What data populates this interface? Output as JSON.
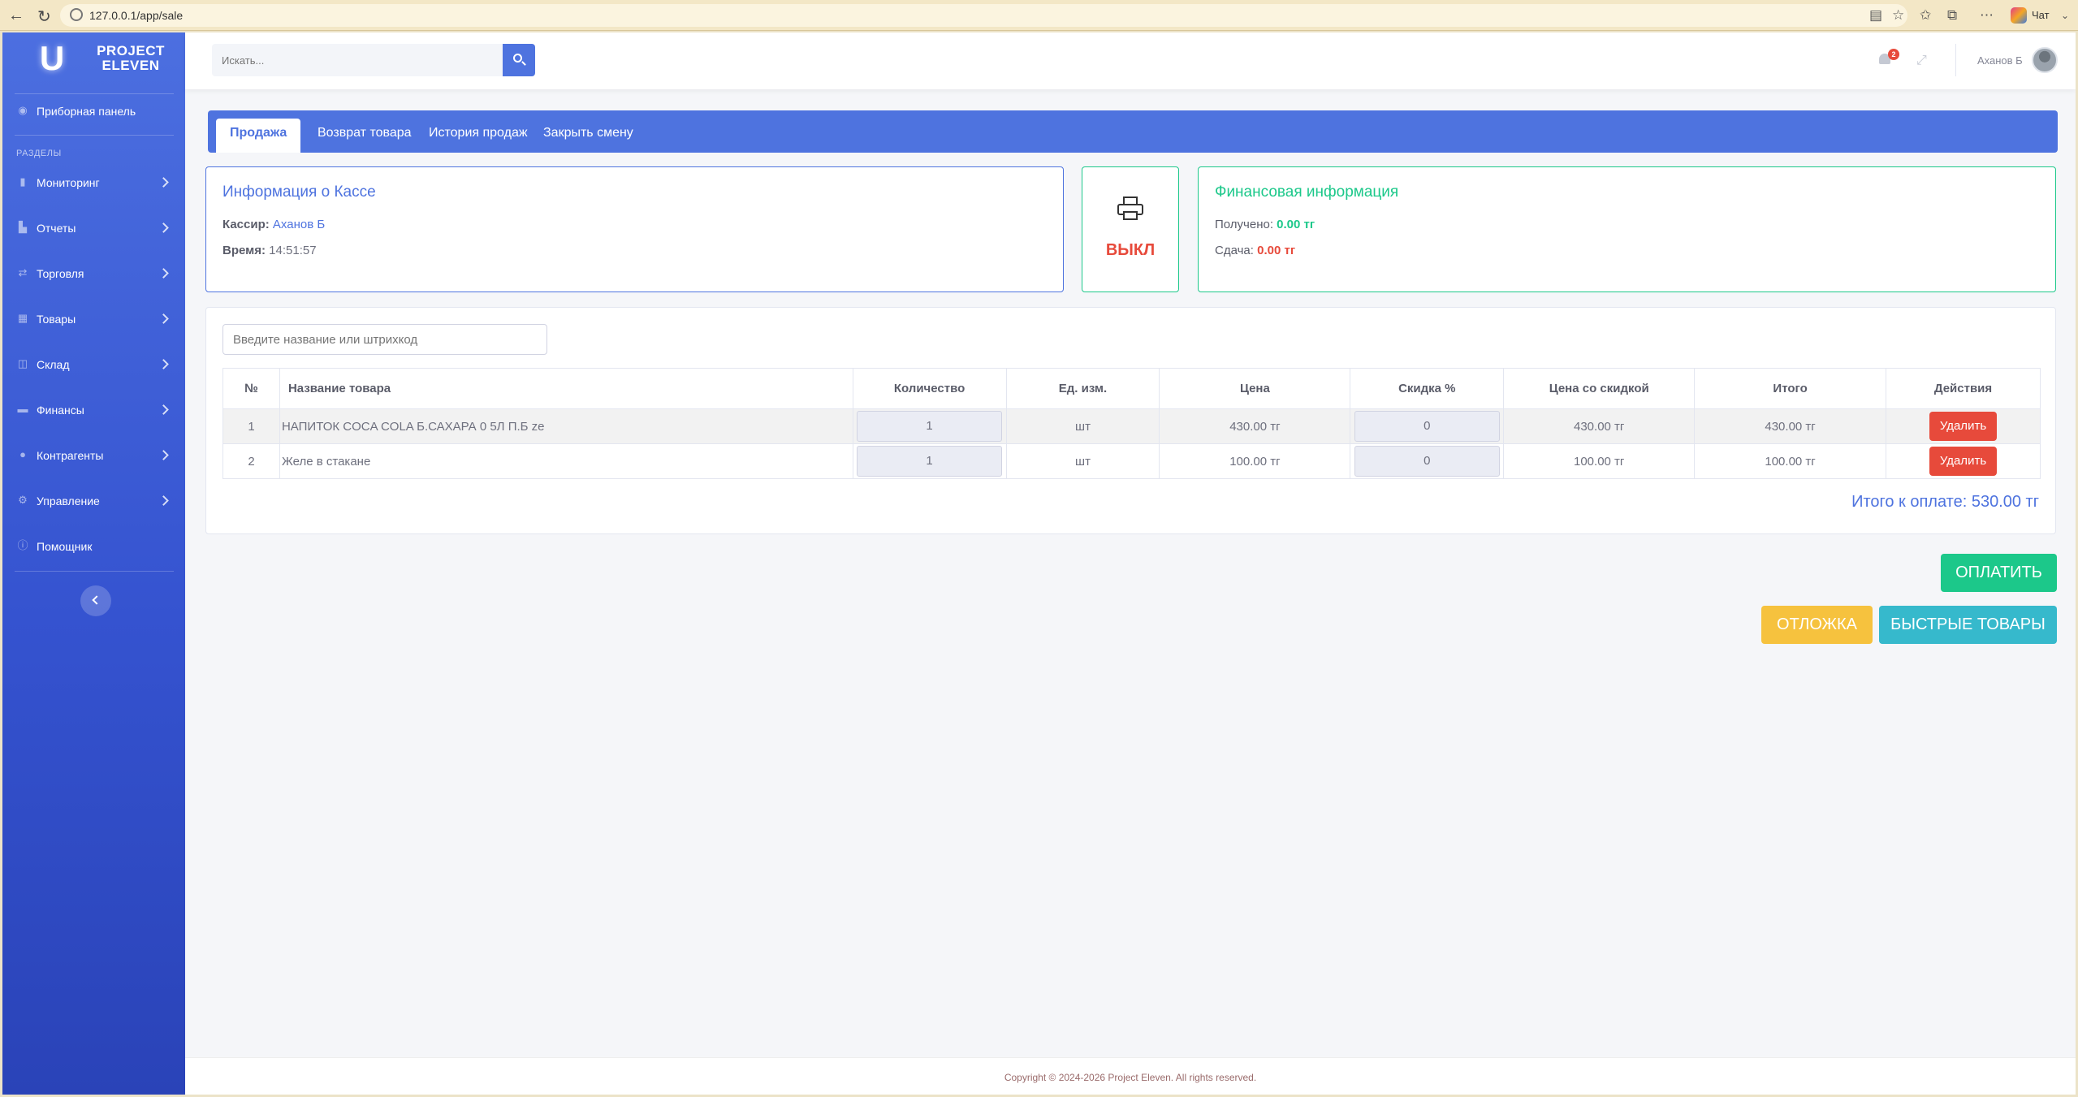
{
  "browser": {
    "url": "127.0.0.1/app/sale",
    "chat_label": "Чат"
  },
  "brand": {
    "logo_letter": "U",
    "name_line1": "PROJECT",
    "name_line2": "ELEVEN"
  },
  "sidebar": {
    "dashboard": "Приборная панель",
    "section_heading": "РАЗДЕЛЫ",
    "items": [
      {
        "label": "Мониторинг",
        "icon": "chart-bar-icon"
      },
      {
        "label": "Отчеты",
        "icon": "chart-line-icon"
      },
      {
        "label": "Торговля",
        "icon": "exchange-icon"
      },
      {
        "label": "Товары",
        "icon": "table-icon"
      },
      {
        "label": "Склад",
        "icon": "warehouse-icon"
      },
      {
        "label": "Финансы",
        "icon": "money-icon"
      },
      {
        "label": "Контрагенты",
        "icon": "user-icon"
      },
      {
        "label": "Управление",
        "icon": "gear-icon"
      }
    ],
    "helper": "Помощник"
  },
  "topbar": {
    "search_placeholder": "Искать...",
    "notification_count": "2",
    "user_name": "Аханов Б"
  },
  "tabs": [
    {
      "label": "Продажа",
      "active": true
    },
    {
      "label": "Возврат товара",
      "active": false
    },
    {
      "label": "История продаж",
      "active": false
    },
    {
      "label": "Закрыть смену",
      "active": false
    }
  ],
  "cash_info": {
    "title": "Информация о Кассе",
    "cashier_label": "Кассир:",
    "cashier_value": "Аханов Б",
    "time_label": "Время:",
    "time_value": "14:51:57"
  },
  "printer": {
    "status": "ВЫКЛ"
  },
  "finance": {
    "title": "Финансовая информация",
    "received_label": "Получено:",
    "received_value": "0.00 тг",
    "change_label": "Сдача:",
    "change_value": "0.00 тг"
  },
  "cart": {
    "search_placeholder": "Введите название или штрихкод",
    "columns": [
      "№",
      "Название товара",
      "Количество",
      "Ед. изм.",
      "Цена",
      "Скидка %",
      "Цена со скидкой",
      "Итого",
      "Действия"
    ],
    "rows": [
      {
        "num": "1",
        "name": "НАПИТОК COCA COLA Б.САХАРА 0 5Л П.Б ze",
        "qty": "1",
        "unit": "шт",
        "price": "430.00 тг",
        "discount": "0",
        "discounted": "430.00 тг",
        "total": "430.00 тг",
        "action": "Удалить"
      },
      {
        "num": "2",
        "name": "Желе в стакане",
        "qty": "1",
        "unit": "шт",
        "price": "100.00 тг",
        "discount": "0",
        "discounted": "100.00 тг",
        "total": "100.00 тг",
        "action": "Удалить"
      }
    ],
    "total_label": "Итого к оплате: 530.00 тг"
  },
  "actions": {
    "pay": "ОПЛАТИТЬ",
    "defer": "ОТЛОЖКА",
    "quick": "БЫСТРЫЕ ТОВАРЫ"
  },
  "footer": {
    "copyright": "Copyright © 2024-2026 Project Eleven. All rights reserved."
  },
  "colors": {
    "primary": "#4e73df",
    "success": "#1cc88a",
    "danger": "#e74a3b",
    "warning": "#f6c23e",
    "info": "#36b9cc"
  }
}
